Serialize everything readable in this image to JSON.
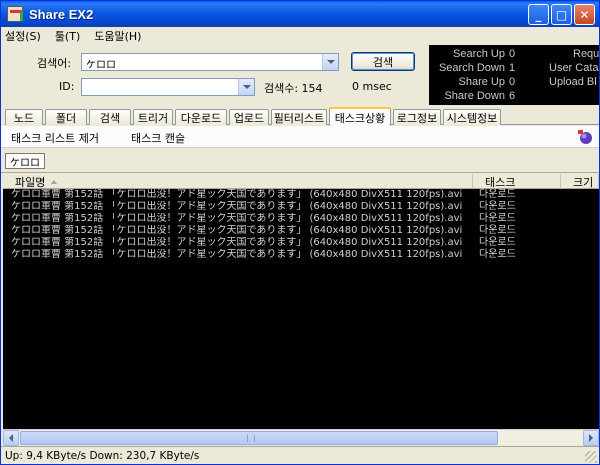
{
  "window": {
    "title": "Share EX2"
  },
  "titlebar_buttons": {
    "minimize": "_",
    "maximize": "□",
    "close": "✕"
  },
  "menu": [
    "설정(S)",
    "툴(T)",
    "도움말(H)"
  ],
  "search": {
    "keyword_label": "검색어:",
    "keyword_value": "ケロロ",
    "id_label": "ID:",
    "id_value": "",
    "search_button": "검색",
    "result_count": "검색수: 154",
    "elapsed": "0 msec"
  },
  "stats": {
    "search_up": "Search Up",
    "search_up_val": "0",
    "search_down": "Search Down",
    "search_down_val": "1",
    "share_up": "Share Up",
    "share_up_val": "0",
    "share_down": "Share Down",
    "share_down_val": "6",
    "req": "Requ",
    "user_catalog": "User Cata",
    "upload_bl": "Upload Bl"
  },
  "tabs": [
    "노드",
    "폴더",
    "검색",
    "트리거",
    "다운로드",
    "업로드",
    "필터리스트",
    "태스크상황",
    "로그정보",
    "시스템정보"
  ],
  "active_tab": "태스크상황",
  "actions": {
    "remove_list": "태스크 리스트 제거",
    "cancel_task": "태스크 캔슬"
  },
  "subtab": "ケロロ",
  "list": {
    "headers": [
      "파일명",
      "태스크",
      "크기"
    ],
    "rows": [
      {
        "file": "ケロロ軍曹 第152話 「ケロロ出没！アド星ック天国であります」 (640x480 DivX511 120fps).avi",
        "task": "다운로드",
        "size": ""
      },
      {
        "file": "ケロロ軍曹 第152話 「ケロロ出没！アド星ック天国であります」 (640x480 DivX511 120fps).avi",
        "task": "다운로드",
        "size": ""
      },
      {
        "file": "ケロロ軍曹 第152話 「ケロロ出没！アド星ック天国であります」 (640x480 DivX511 120fps).avi",
        "task": "다운로드",
        "size": ""
      },
      {
        "file": "ケロロ軍曹 第152話 「ケロロ出没！アド星ック天国であります」 (640x480 DivX511 120fps).avi",
        "task": "다운로드",
        "size": ""
      },
      {
        "file": "ケロロ軍曹 第152話 「ケロロ出没！アド星ック天国であります」 (640x480 DivX511 120fps).avi",
        "task": "다운로드",
        "size": ""
      },
      {
        "file": "ケロロ軍曹 第152話 「ケロロ出没！アド星ック天国であります」 (640x480 DivX511 120fps).avi",
        "task": "다운로드",
        "size": ""
      }
    ]
  },
  "status": "Up: 9,4 KByte/s  Down: 230,7 KByte/s",
  "colors": {
    "accent": "#0548d1",
    "list_bg": "#000000",
    "active_tab_line": "#ffc83c"
  }
}
